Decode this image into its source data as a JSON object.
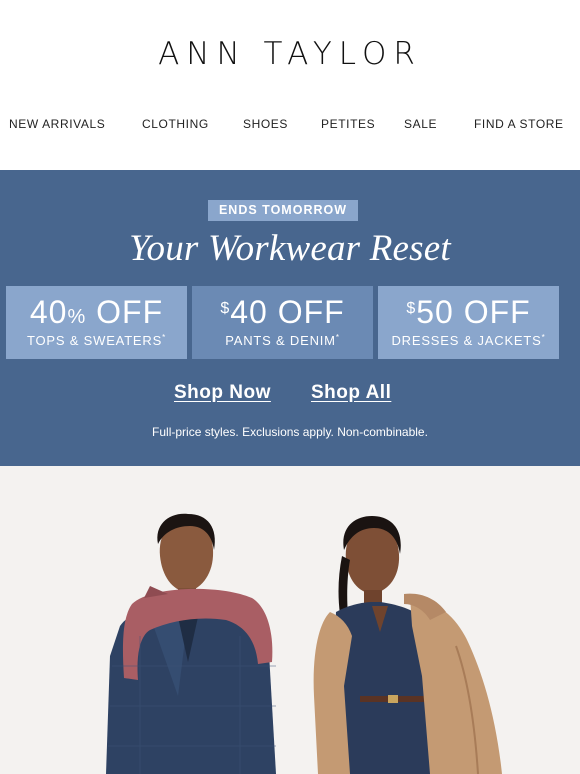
{
  "brand": {
    "logo_text": "ANN TAYLOR"
  },
  "nav": {
    "items": [
      {
        "label": "NEW ARRIVALS"
      },
      {
        "label": "CLOTHING"
      },
      {
        "label": "SHOES"
      },
      {
        "label": "PETITES"
      },
      {
        "label": "SALE"
      },
      {
        "label": "FIND A STORE"
      }
    ]
  },
  "promo": {
    "badge": "ENDS TOMORROW",
    "headline": "Your Workwear Reset",
    "offers": [
      {
        "pre": "40",
        "pct": "%",
        "main": " OFF",
        "sub": "TOPS & SWEATERS",
        "mark": "*"
      },
      {
        "pre": "$",
        "main": "40 OFF",
        "sub": "PANTS & DENIM",
        "mark": "*"
      },
      {
        "pre": "$",
        "main": "50 OFF",
        "sub": "DRESSES & JACKETS",
        "mark": "*"
      }
    ],
    "shop_now": "Shop Now",
    "shop_all": "Shop All",
    "disclaimer": "Full-price styles. Exclusions apply. Non-combinable.",
    "colors": {
      "banner": "#48668e",
      "tile_light": "#8aa6cc",
      "tile_mid": "#6b8ab4"
    }
  },
  "hero": {
    "background": "#f4f2f0"
  }
}
